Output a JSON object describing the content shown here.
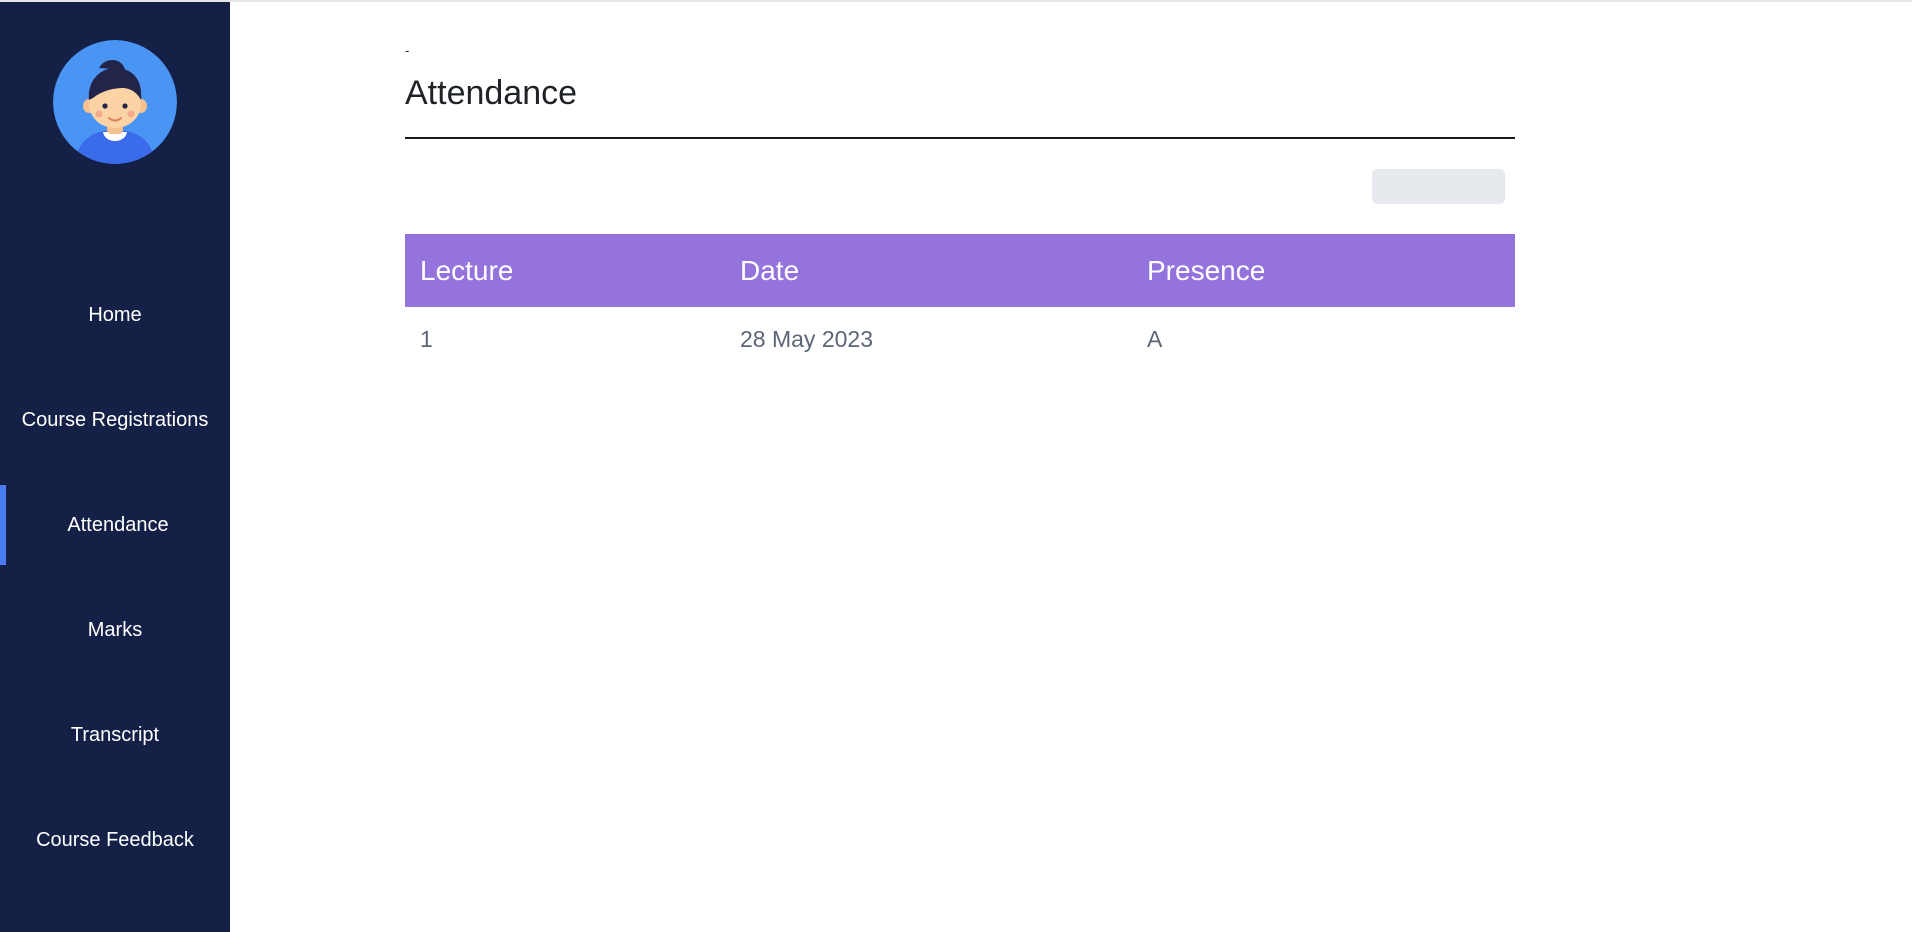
{
  "sidebar": {
    "avatar_label": "user-avatar",
    "items": [
      {
        "label": "Home",
        "active": false
      },
      {
        "label": "Course Registrations",
        "active": false
      },
      {
        "label": "Attendance",
        "active": true
      },
      {
        "label": "Marks",
        "active": false
      },
      {
        "label": "Transcript",
        "active": false
      },
      {
        "label": "Course Feedback",
        "active": false
      }
    ]
  },
  "main": {
    "dash": "-",
    "title": "Attendance",
    "table": {
      "headers": [
        "Lecture",
        "Date",
        "Presence"
      ],
      "rows": [
        [
          "1",
          "28 May 2023",
          "A"
        ]
      ]
    }
  },
  "colors": {
    "sidebar_bg": "#142046",
    "active_indicator": "#4a7cf6",
    "table_header_bg": "#9573dc",
    "avatar_bg": "#4a95f4"
  }
}
